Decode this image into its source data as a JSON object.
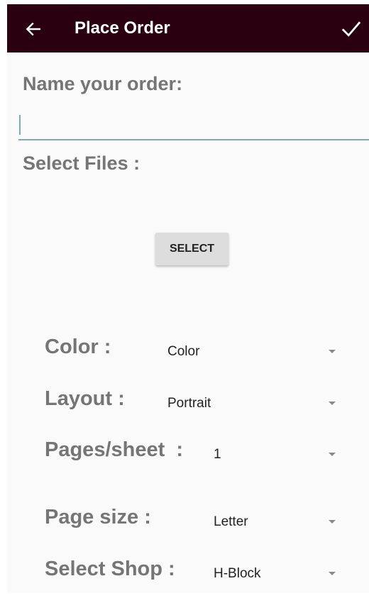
{
  "appbar": {
    "title": "Place Order",
    "back_icon": "arrow-left-icon",
    "confirm_icon": "checkmark-icon",
    "background": "#2a0010"
  },
  "order_name": {
    "label": "Name your order:",
    "value": "",
    "placeholder": ""
  },
  "files": {
    "label": "Select Files :",
    "select_button_label": "SELECT"
  },
  "options": {
    "color": {
      "label": "Color :",
      "value": "Color"
    },
    "layout": {
      "label": "Layout :",
      "value": "Portrait"
    },
    "pages_per_sheet": {
      "label": "Pages/sheet  :",
      "value": "1"
    },
    "page_size": {
      "label": "Page size :",
      "value": "Letter"
    },
    "shop": {
      "label": "Select Shop :",
      "value": "H-Block"
    }
  }
}
